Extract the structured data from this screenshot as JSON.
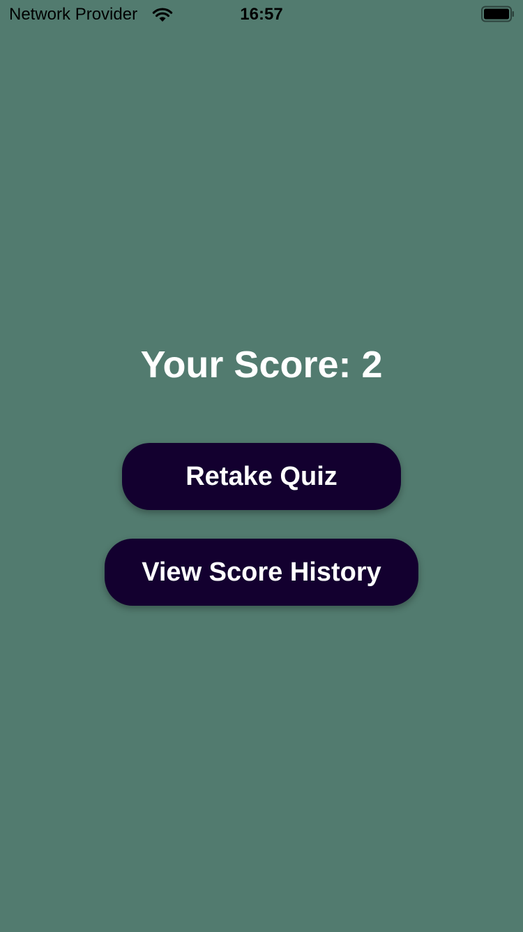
{
  "status_bar": {
    "carrier": "Network Provider",
    "time": "16:57",
    "wifi_icon": "wifi-icon",
    "battery_icon": "battery-icon"
  },
  "result": {
    "score_text": "Your Score: 2"
  },
  "actions": {
    "retake_label": "Retake Quiz",
    "history_label": "View Score History"
  },
  "colors": {
    "background": "#527b6f",
    "button": "#13002f",
    "text": "#ffffff"
  }
}
